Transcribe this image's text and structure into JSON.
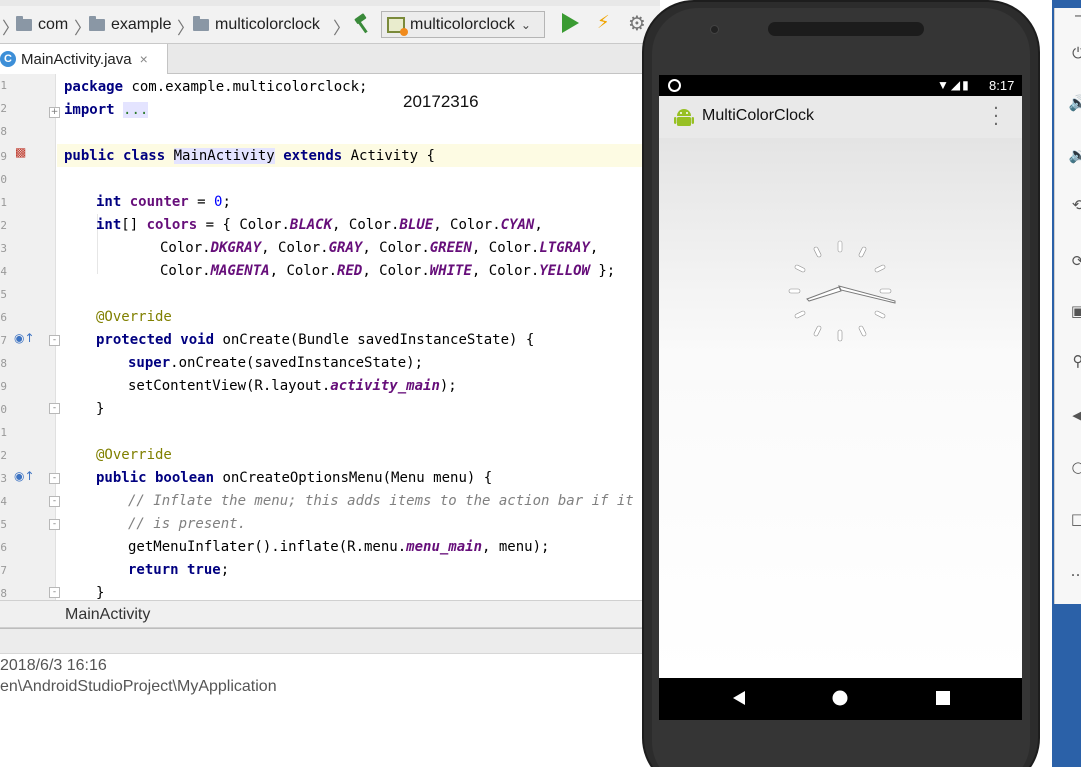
{
  "ide": {
    "breadcrumbs": [
      "com",
      "example",
      "multicolorclock"
    ],
    "run_config": "multicolorclock",
    "icons": {
      "hammer": "hammer-icon",
      "run": "run-icon",
      "apply": "lightning-icon",
      "settings": "gear-icon",
      "config": "android-config-icon",
      "chevron": "chevron-down-icon"
    },
    "tab": {
      "label": "MainActivity.java",
      "icon_letter": "C"
    },
    "stamp": "20172316",
    "code_lines": [
      "package com.example.multicolorclock;",
      "import ...",
      "public class MainActivity extends Activity {",
      "int counter = 0;",
      "int[] colors = { Color.BLACK, Color.BLUE, Color.CYAN,",
      "Color.DKGRAY, Color.GRAY, Color.GREEN, Color.LTGRAY,",
      "Color.MAGENTA, Color.RED, Color.WHITE, Color.YELLOW };",
      "@Override",
      "protected void onCreate(Bundle savedInstanceState) {",
      "super.onCreate(savedInstanceState);",
      "setContentView(R.layout.activity_main);",
      "}",
      "@Override",
      "public boolean onCreateOptionsMenu(Menu menu) {",
      "// Inflate the menu; this adds items to the action bar if it",
      "// is present.",
      "getMenuInflater().inflate(R.menu.menu_main, menu);",
      "return true;",
      "}"
    ],
    "line_numbers": [
      "1",
      "2",
      "8",
      "9",
      "0",
      "1",
      "2",
      "3",
      "4",
      "5",
      "6",
      "7",
      "8",
      "9",
      "0",
      "1",
      "2",
      "3",
      "4",
      "5",
      "6",
      "7",
      "8"
    ],
    "code_breadcrumb": "MainActivity",
    "info": {
      "date": "2018/6/3 16:16",
      "path": "en\\AndroidStudioProject\\MyApplication"
    },
    "accent": "#3d8fd8"
  },
  "emulator": {
    "status_time": "8:17",
    "status_icons": [
      "wifi-icon",
      "signal-icon",
      "battery-icon"
    ],
    "app_title": "MultiColorClock",
    "app_icon": "android-robot-icon",
    "overflow_icon": "overflow-menu-icon",
    "nav": [
      "back-icon",
      "home-icon",
      "recents-icon"
    ]
  }
}
